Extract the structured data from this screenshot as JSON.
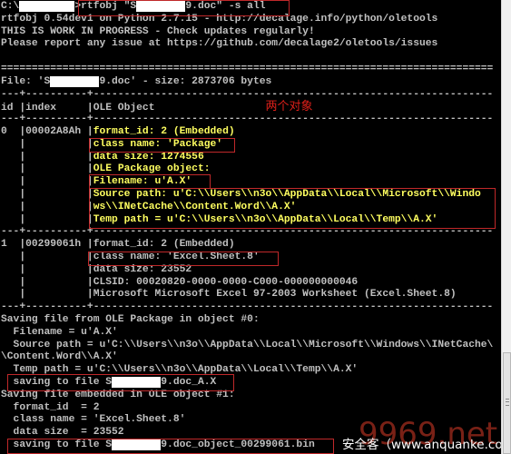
{
  "window": {
    "type": "console",
    "background": "#000000",
    "text_color": "#c0c0c0",
    "highlight_color": "#ffff60",
    "annotation_color": "#c0282a"
  },
  "terminal": {
    "lines": [
      {
        "segments": [
          {
            "t": "C:\\"
          },
          {
            "t": "         ",
            "c": "r"
          },
          {
            "t": ">rtfobj \"S"
          },
          {
            "t": "        ",
            "c": "r"
          },
          {
            "t": "9.doc\" -s all"
          }
        ]
      },
      {
        "segments": [
          {
            "t": "rtfobj 0.54dev1 on Python 2.7.15 - http://decalage.info/python/oletools"
          }
        ]
      },
      {
        "segments": [
          {
            "t": "THIS IS WORK IN PROGRESS - Check updates regularly!"
          }
        ]
      },
      {
        "segments": [
          {
            "t": "Please report any issue at https://github.com/decalage2/oletools/issues"
          }
        ]
      },
      {
        "segments": [
          {
            "t": ""
          }
        ]
      },
      {
        "segments": [
          {
            "t": "================================================================================"
          }
        ]
      },
      {
        "segments": [
          {
            "t": "File: 'S"
          },
          {
            "t": "        ",
            "c": "r"
          },
          {
            "t": "9.doc' - size: 2873706 bytes"
          }
        ]
      },
      {
        "segments": [
          {
            "t": "---+----------+-----------------------------------------------------------------"
          }
        ]
      },
      {
        "segments": [
          {
            "t": "id |index     |OLE Object                  "
          },
          {
            "t": "两个对象",
            "c": "cn"
          }
        ]
      },
      {
        "segments": [
          {
            "t": "---+----------+-----------------------------------------------------------------"
          }
        ]
      },
      {
        "segments": [
          {
            "t": "0  |00002A8Ah |"
          },
          {
            "t": "format_id: 2 (Embedded)",
            "c": "y"
          }
        ]
      },
      {
        "segments": [
          {
            "t": "   |          |"
          },
          {
            "t": "class name: 'Package'",
            "c": "y"
          }
        ]
      },
      {
        "segments": [
          {
            "t": "   |          |"
          },
          {
            "t": "data size: 1274556",
            "c": "y"
          }
        ]
      },
      {
        "segments": [
          {
            "t": "   |          |"
          },
          {
            "t": "OLE Package object:",
            "c": "y"
          }
        ]
      },
      {
        "segments": [
          {
            "t": "   |          |"
          },
          {
            "t": "Filename: u'A.X'",
            "c": "y"
          }
        ]
      },
      {
        "segments": [
          {
            "t": "   |          |"
          },
          {
            "t": "Source path: u'C:\\\\Users\\\\n3o\\\\AppData\\\\Local\\\\Microsoft\\\\Windo",
            "c": "y"
          }
        ]
      },
      {
        "segments": [
          {
            "t": "   |          |"
          },
          {
            "t": "ws\\\\INetCache\\\\Content.Word\\\\A.X'",
            "c": "y"
          }
        ]
      },
      {
        "segments": [
          {
            "t": "   |          |"
          },
          {
            "t": "Temp path = u'C:\\\\Users\\\\n3o\\\\AppData\\\\Local\\\\Temp\\\\A.X'",
            "c": "y"
          }
        ]
      },
      {
        "segments": [
          {
            "t": "---+----------+-----------------------------------------------------------------"
          }
        ]
      },
      {
        "segments": [
          {
            "t": "1  |00299061h |format_id: 2 (Embedded)"
          }
        ]
      },
      {
        "segments": [
          {
            "t": "   |          |class name: 'Excel.Sheet.8'"
          }
        ]
      },
      {
        "segments": [
          {
            "t": "   |          |data size: 23552"
          }
        ]
      },
      {
        "segments": [
          {
            "t": "   |          |CLSID: 00020820-0000-0000-C000-000000000046"
          }
        ]
      },
      {
        "segments": [
          {
            "t": "   |          |Microsoft Microsoft Excel 97-2003 Worksheet (Excel.Sheet.8)"
          }
        ]
      },
      {
        "segments": [
          {
            "t": "---+----------+-----------------------------------------------------------------"
          }
        ]
      },
      {
        "segments": [
          {
            "t": "Saving file from OLE Package in object #0:"
          }
        ]
      },
      {
        "segments": [
          {
            "t": "  Filename = u'A.X'"
          }
        ]
      },
      {
        "segments": [
          {
            "t": "  Source path = u'C:\\\\Users\\\\n3o\\\\AppData\\\\Local\\\\Microsoft\\\\Windows\\\\INetCache\\"
          }
        ]
      },
      {
        "segments": [
          {
            "t": "\\Content.Word\\\\A.X'"
          }
        ]
      },
      {
        "segments": [
          {
            "t": "  Temp path = u'C:\\\\Users\\\\n3o\\\\AppData\\\\Local\\\\Temp\\\\A.X'"
          }
        ]
      },
      {
        "segments": [
          {
            "t": "  saving to file S"
          },
          {
            "t": "        ",
            "c": "r"
          },
          {
            "t": "9.doc_A.X"
          }
        ]
      },
      {
        "segments": [
          {
            "t": "Saving file embedded in OLE object #1:"
          }
        ]
      },
      {
        "segments": [
          {
            "t": "  format_id  = 2"
          }
        ]
      },
      {
        "segments": [
          {
            "t": "  class name = 'Excel.Sheet.8'"
          }
        ]
      },
      {
        "segments": [
          {
            "t": "  data size  = 23552"
          }
        ]
      },
      {
        "segments": [
          {
            "t": "  saving to file S"
          },
          {
            "t": "        ",
            "c": "r"
          },
          {
            "t": "9.doc_object_00299061.bin"
          }
        ]
      }
    ]
  },
  "watermark": {
    "text": "安全客（www.anquanke.com）",
    "faint_text": "9969.net"
  }
}
